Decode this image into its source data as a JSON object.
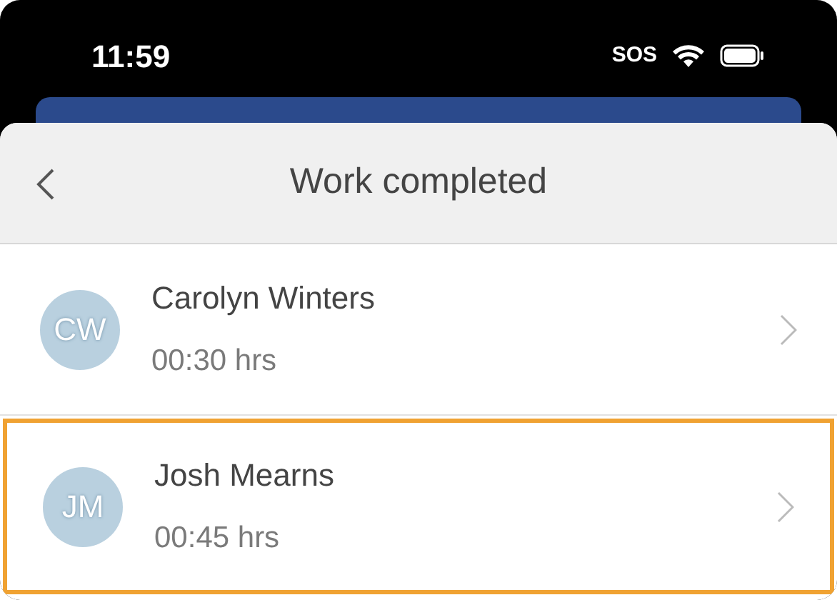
{
  "status_bar": {
    "time": "11:59",
    "carrier": "SOS"
  },
  "header": {
    "title": "Work completed"
  },
  "rows": [
    {
      "initials": "CW",
      "name": "Carolyn Winters",
      "duration": "00:30 hrs",
      "selected": false
    },
    {
      "initials": "JM",
      "name": "Josh Mearns",
      "duration": "00:45 hrs",
      "selected": true
    }
  ]
}
